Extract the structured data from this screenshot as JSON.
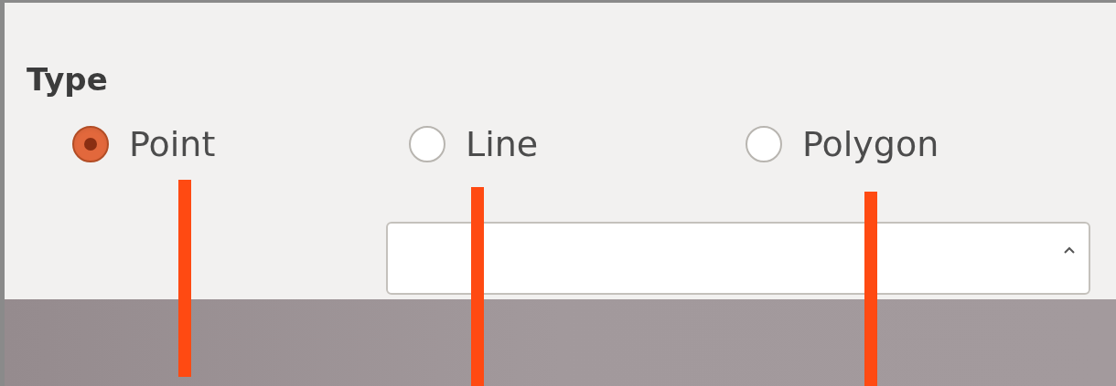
{
  "section": {
    "title": "Type"
  },
  "options": [
    {
      "label": "Point",
      "selected": true
    },
    {
      "label": "Line",
      "selected": false
    },
    {
      "label": "Polygon",
      "selected": false
    }
  ]
}
